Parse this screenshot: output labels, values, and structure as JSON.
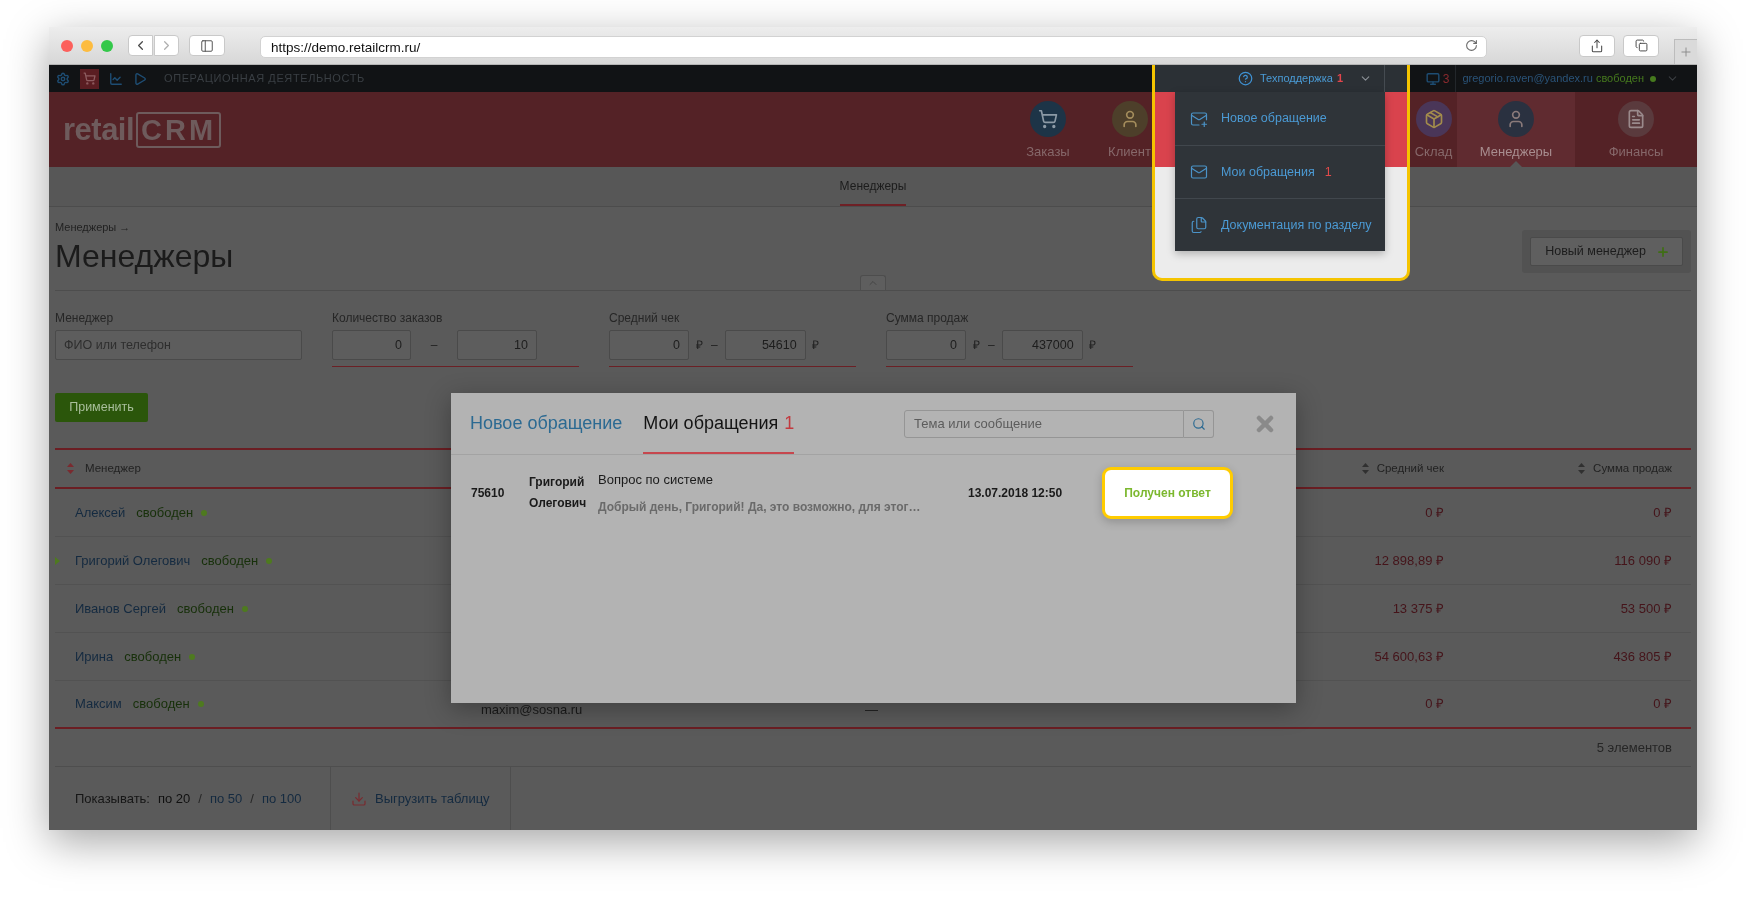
{
  "browser": {
    "url": "https://demo.retailcrm.ru/"
  },
  "top_bar": {
    "apps": [
      {
        "kind": "settings",
        "selected": false
      },
      {
        "kind": "orders",
        "selected": true
      },
      {
        "kind": "analytics",
        "selected": false
      },
      {
        "kind": "play",
        "selected": false
      }
    ],
    "section": "ОПЕРАЦИОННАЯ ДЕЯТЕЛЬНОСТЬ",
    "support": {
      "label": "Техподдержка",
      "count": "1",
      "expanded": true,
      "highlighted": true,
      "menu": [
        {
          "kind": "new",
          "label": "Новое обращение"
        },
        {
          "kind": "mine",
          "label": "Мои обращения",
          "count": "1"
        },
        {
          "kind": "docs",
          "label": "Документация по разделу"
        }
      ]
    },
    "calls_count": "3",
    "user": {
      "email": "gregorio.raven@yandex.ru",
      "status": "свободен"
    }
  },
  "header": {
    "logo": {
      "prefix": "retail",
      "suffix": "CRM"
    },
    "nav": [
      {
        "kind": "orders",
        "label": "Заказы",
        "selected": false
      },
      {
        "kind": "customers",
        "label": "Клиент",
        "selected": false
      },
      {
        "kind": "warehouse",
        "label": "Склад",
        "selected": false
      },
      {
        "kind": "managers",
        "label": "Менеджеры",
        "selected": true
      },
      {
        "kind": "finance",
        "label": "Финансы",
        "selected": false
      }
    ]
  },
  "subnav": {
    "tabs": [
      {
        "label": "Менеджеры",
        "selected": true
      }
    ]
  },
  "page": {
    "breadcrumb": "Менеджеры →",
    "title": "Менеджеры",
    "new_button": "Новый менеджер",
    "filters": [
      {
        "kind": "text",
        "label": "Менеджер",
        "placeholder": "ФИО или телефон"
      },
      {
        "kind": "range",
        "label": "Количество заказов",
        "from": "0",
        "separator": "–",
        "to": "10"
      },
      {
        "kind": "money_range",
        "label": "Средний чек",
        "from": "0",
        "from_unit": "₽",
        "separator": "–",
        "to": "54610",
        "to_unit": "₽"
      },
      {
        "kind": "money_range",
        "label": "Сумма продаж",
        "from": "0",
        "from_unit": "₽",
        "separator": "–",
        "to": "437000",
        "to_unit": "₽"
      }
    ],
    "apply_button": "Применить"
  },
  "table": {
    "columns": [
      {
        "kind": "manager",
        "label": "Менеджер"
      },
      {
        "kind": "avg_check",
        "label": "Средний чек"
      },
      {
        "kind": "sales",
        "label": "Сумма продаж"
      }
    ],
    "rows": [
      {
        "manager": "Алексей",
        "status": "свободен",
        "marked": false,
        "avg_check": "0 ₽",
        "sales": "0 ₽"
      },
      {
        "manager": "Григорий Олегович",
        "status": "свободен",
        "marked": true,
        "avg_check": "12 898,89 ₽",
        "sales": "116 090 ₽"
      },
      {
        "manager": "Иванов Сергей",
        "status": "свободен",
        "marked": false,
        "avg_check": "13 375 ₽",
        "sales": "53 500 ₽"
      },
      {
        "manager": "Ирина",
        "status": "свободен",
        "marked": false,
        "avg_check": "54 600,63 ₽",
        "sales": "436 805 ₽"
      },
      {
        "manager": "Максим",
        "status": "свободен",
        "marked": false,
        "column_2": "maxim@sosna.ru",
        "column_3": "—",
        "avg_check": "0 ₽",
        "sales": "0 ₽"
      }
    ],
    "count": "5 элементов"
  },
  "footer": {
    "page_size_label": "Показывать:",
    "page_sizes": [
      {
        "label": "по 20",
        "selected": true
      },
      {
        "label": "по 50",
        "selected": false,
        "separator": "/"
      },
      {
        "label": "по 100",
        "selected": false,
        "separator": "/"
      }
    ],
    "export_button": "Выгрузить таблицу"
  },
  "modal": {
    "tabs": [
      {
        "label": "Новое обращение",
        "selected": false
      },
      {
        "label": "Мои обращения",
        "count": "1",
        "selected": true
      }
    ],
    "search": {
      "placeholder": "Тема или сообщение"
    },
    "tickets": [
      {
        "id": "75610",
        "author": "Григорий Олегович",
        "subject": "Вопрос по системе",
        "preview": "Добрый день, Григорий! Да, это возможно, для этог…",
        "date": "13.07.2018 12:50",
        "status": "Получен ответ",
        "highlighted": true
      }
    ]
  }
}
